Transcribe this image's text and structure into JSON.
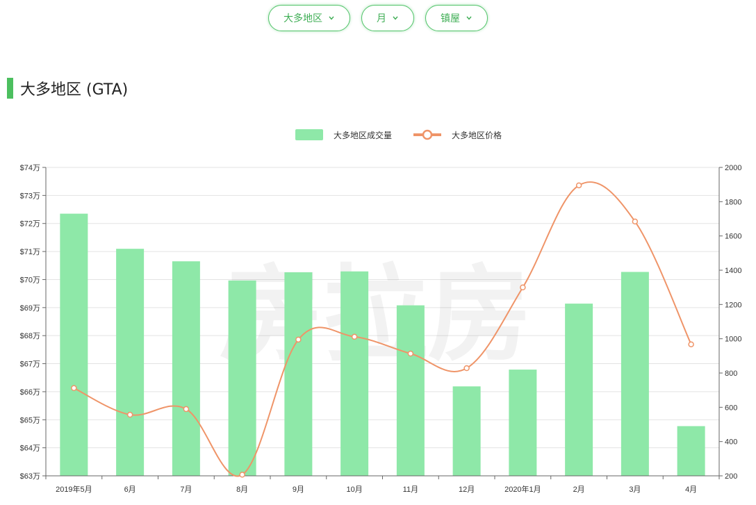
{
  "filters": {
    "region": "大多地区",
    "period": "月",
    "type": "镇屋"
  },
  "section": {
    "title": "大多地区 (GTA)"
  },
  "watermark": "房拉房",
  "colors": {
    "accent": "#4cbf5f",
    "bar": "#8ee8a8",
    "line": "#ef9468"
  },
  "chart_data": {
    "type": "bar",
    "categories": [
      "2019年5月",
      "6月",
      "7月",
      "8月",
      "9月",
      "10月",
      "11月",
      "12月",
      "2020年1月",
      "2月",
      "3月",
      "4月"
    ],
    "series": [
      {
        "name": "大多地区成交量",
        "type": "bar",
        "axis": "right",
        "values": [
          1730,
          1525,
          1452,
          1340,
          1388,
          1393,
          1195,
          722,
          820,
          1205,
          1390,
          490
        ]
      },
      {
        "name": "大多地区价格",
        "type": "line",
        "axis": "left",
        "smooth": true,
        "values": [
          661300,
          651800,
          653800,
          630400,
          678600,
          679600,
          673600,
          668400,
          697200,
          733600,
          720700,
          676900
        ]
      }
    ],
    "y_left": {
      "min": 630000,
      "max": 740000,
      "ticks": [
        {
          "value": 740000,
          "label": "$74万"
        },
        {
          "value": 730000,
          "label": "$73万"
        },
        {
          "value": 720000,
          "label": "$72万"
        },
        {
          "value": 710000,
          "label": "$71万"
        },
        {
          "value": 700000,
          "label": "$70万"
        },
        {
          "value": 690000,
          "label": "$69万"
        },
        {
          "value": 680000,
          "label": "$68万"
        },
        {
          "value": 670000,
          "label": "$67万"
        },
        {
          "value": 660000,
          "label": "$66万"
        },
        {
          "value": 650000,
          "label": "$65万"
        },
        {
          "value": 640000,
          "label": "$64万"
        },
        {
          "value": 630000,
          "label": "$63万"
        }
      ]
    },
    "y_right": {
      "min": 200,
      "max": 2000,
      "ticks": [
        {
          "value": 2000,
          "label": "2000"
        },
        {
          "value": 1800,
          "label": "1800"
        },
        {
          "value": 1600,
          "label": "1600"
        },
        {
          "value": 1400,
          "label": "1400"
        },
        {
          "value": 1200,
          "label": "1200"
        },
        {
          "value": 1000,
          "label": "1000"
        },
        {
          "value": 800,
          "label": "800"
        },
        {
          "value": 600,
          "label": "600"
        },
        {
          "value": 400,
          "label": "400"
        },
        {
          "value": 200,
          "label": "200"
        }
      ]
    },
    "grid": true,
    "legend": "top-center"
  }
}
